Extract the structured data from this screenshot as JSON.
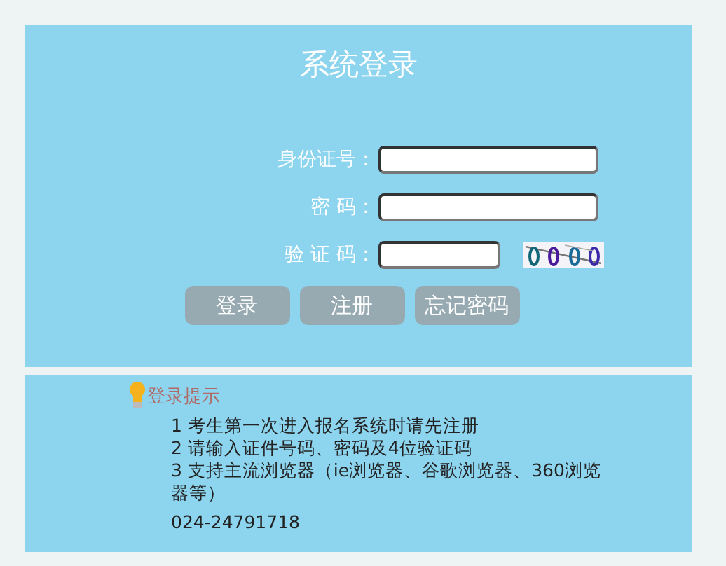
{
  "title": "系统登录",
  "fields": [
    {
      "label": "身份证号：",
      "kind": "text"
    },
    {
      "label": "密 码：",
      "kind": "password"
    },
    {
      "label": "验 证 码：",
      "kind": "captcha"
    }
  ],
  "buttons": [
    "登录",
    "注册",
    "忘记密码"
  ],
  "tips": {
    "heading": "登录提示",
    "lines": [
      "1 考生第一次进入报名系统时请先注册",
      "2 请输入证件号码、密码及4位验证码",
      "3 支持主流浏览器（ie浏览器、谷歌浏览器、360浏览器等）"
    ],
    "phone": "024-24791718"
  }
}
